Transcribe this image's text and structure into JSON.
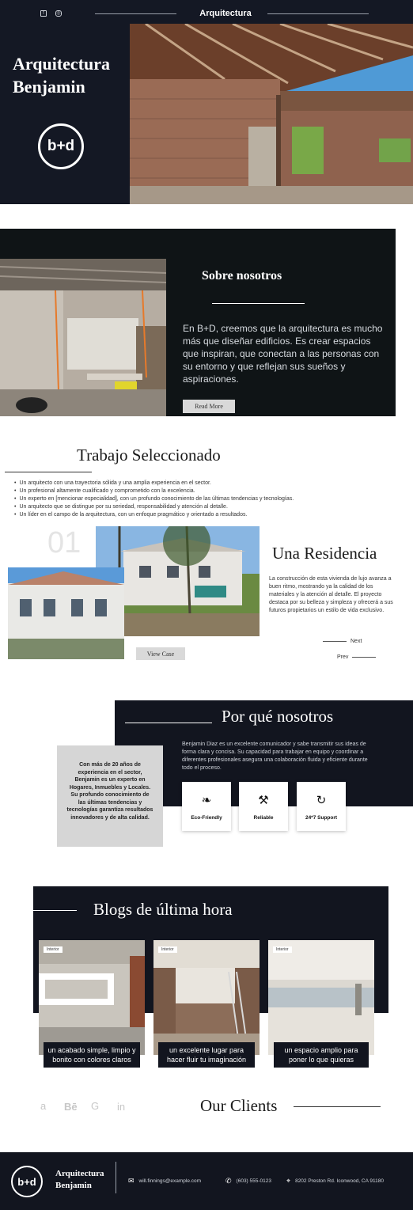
{
  "header": {
    "nav_title": "Arquitectura",
    "social_icons": [
      "facebook-icon",
      "instagram-icon"
    ]
  },
  "hero": {
    "title_line1": "Arquitectura",
    "title_line2": "Benjamin",
    "logo_text": "b+d"
  },
  "about": {
    "title": "Sobre nosotros",
    "text": "En B+D, creemos que la arquitectura es mucho más que diseñar edificios. Es crear espacios que inspiran, que conectan a las personas con su entorno y que reflejan sus sueños y aspiraciones.",
    "button": "Read More"
  },
  "work": {
    "title": "Trabajo Seleccionado",
    "bullets": [
      "Un arquitecto con una trayectoria sólida y una amplia experiencia en el sector.",
      "Un profesional altamente cualificado y comprometido con la excelencia.",
      "Un experto en [mencionar especialidad], con un profundo conocimiento de las últimas tendencias y tecnologías.",
      "Un arquitecto que se distingue por su seriedad, responsabilidad y atención al detalle.",
      "Un líder en el campo de la arquitectura, con un enfoque pragmático y orientado a resultados."
    ],
    "number": "01",
    "project_title": "Una Residencia",
    "project_text": "La construcción de esta vivienda de lujo avanza a buen ritmo, mostrando ya la calidad de los materiales y la atención al detalle. El proyecto destaca por su belleza y simpleza y ofrecerá a sus futuros propietarios un estilo de vida exclusivo.",
    "next": "Next",
    "prev": "Prev",
    "view_case": "View Case"
  },
  "why": {
    "title": "Por qué nosotros",
    "text": "Benjamin Diaz es un excelente comunicador y sabe transmitir sus ideas de forma clara y concisa. Su capacidad para trabajar en equipo y coordinar a diferentes profesionales asegura una colaboración fluida y eficiente durante todo el proceso.",
    "box_text": "Con más de 20 años de experiencia en el sector, Benjamin es un experto en Hogares, Inmuebles y Locales. Su profundo conocimiento de las últimas tendencias y tecnologías garantiza resultados innovadores y de alta calidad.",
    "features": [
      {
        "icon": "leaf-icon",
        "label": "Eco-Friendly"
      },
      {
        "icon": "tools-icon",
        "label": "Reliable"
      },
      {
        "icon": "support-24-icon",
        "label": "24*7 Support"
      }
    ]
  },
  "blogs": {
    "title": "Blogs de última hora",
    "cards": [
      {
        "tag": "Interior",
        "caption": "un acabado simple, limpio y bonito con colores claros"
      },
      {
        "tag": "Interior",
        "caption": "un excelente lugar para hacer fluir tu imaginación"
      },
      {
        "tag": "Interior",
        "caption": "un espacio amplio para poner lo que quieras"
      }
    ]
  },
  "clients": {
    "title": "Our Clients",
    "logos": [
      "amazon-icon",
      "behance-icon",
      "google-icon",
      "linkedin-icon"
    ]
  },
  "footer": {
    "logo_text": "b+d",
    "brand_line1": "Arquitectura",
    "brand_line2": "Benjamin",
    "email": "will.finnings@example.com",
    "phone": "(603) 555-0123",
    "address": "8202 Preston Rd. Iconwood, CA 91180"
  }
}
